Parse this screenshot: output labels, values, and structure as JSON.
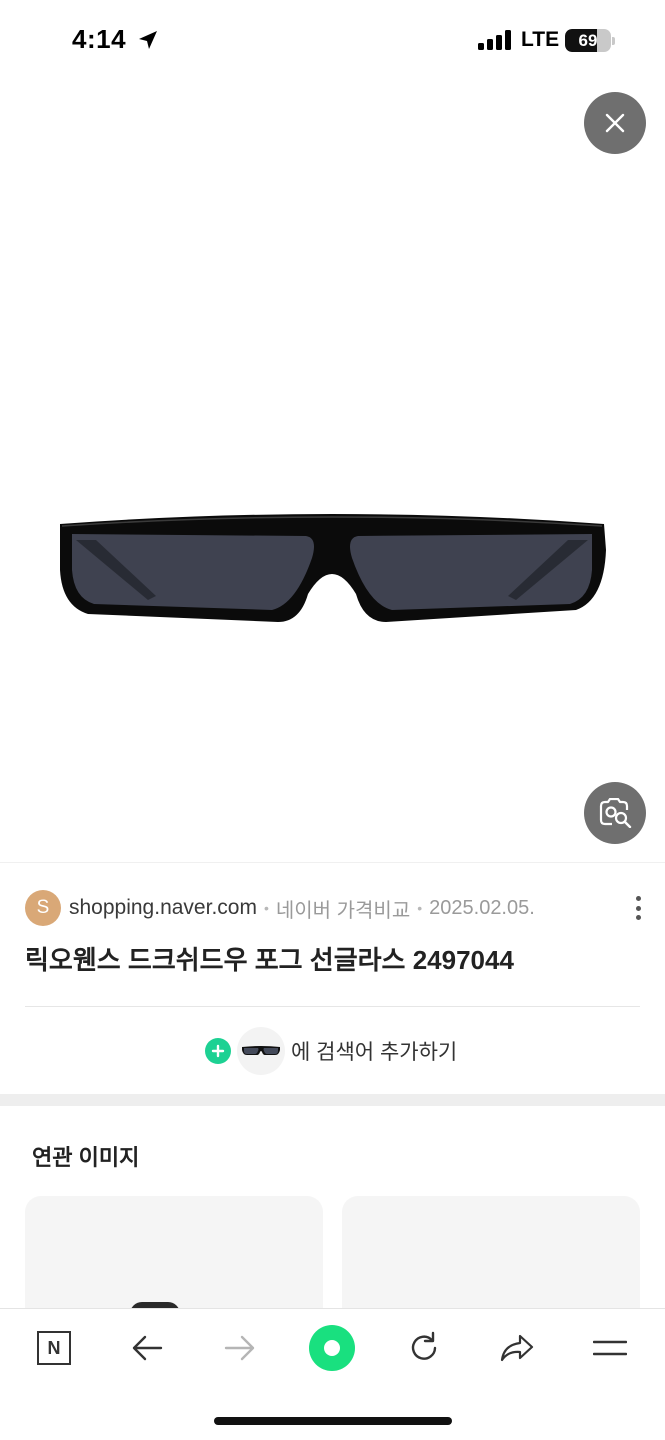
{
  "status_bar": {
    "time": "4:14",
    "network": "LTE",
    "battery": "69",
    "battery_fraction": 0.69
  },
  "viewer": {
    "close_icon": "close-icon",
    "lens_icon": "image-search-icon"
  },
  "source": {
    "favicon_letter": "S",
    "domain": "shopping.naver.com",
    "separator": "•",
    "category": "네이버 가격비교",
    "date": "2025.02.05."
  },
  "product": {
    "title": "릭오웬스 드크쉬드우 포그 선글라스 2497044"
  },
  "add_keyword": {
    "label": "에 검색어 추가하기"
  },
  "related": {
    "title": "연관 이미지"
  },
  "bottom_nav": {
    "home_letter": "N",
    "items": [
      "naver-home-icon",
      "back-arrow-icon",
      "forward-arrow-icon",
      "green-dot-icon",
      "reload-icon",
      "share-icon",
      "menu-icon"
    ]
  },
  "colors": {
    "accent_green": "#19e07f",
    "plus_green": "#1dd193",
    "favicon": "#d9a877",
    "overlay_button": "#6f6f6f"
  }
}
